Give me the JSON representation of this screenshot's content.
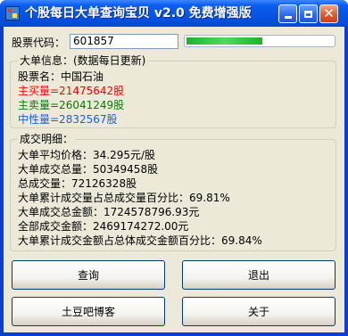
{
  "window": {
    "title": "个股每日大单查询宝贝 v2.0 免费增强版"
  },
  "query": {
    "stock_code_label": "股票代码：",
    "stock_code_value": "601857",
    "progress": 0.52
  },
  "big_order_group": {
    "title": "大单信息：(数据每日更新)",
    "stock_name": "股票名：中国石油",
    "active_buy": "主买量=21475642股",
    "active_sell": "主卖量=26041249股",
    "neutral": "中性量=2832567股"
  },
  "detail_group": {
    "title": "成交明细：",
    "lines": [
      "大单平均价格：34.295元/股",
      "大单成交总量：50349458股",
      "总成交量：72126328股",
      "大单累计成交量占总成交量百分比：69.81%",
      "大单成交总金额：1724578796.93元",
      "全部成交金额：2469174272.00元",
      "大单累计成交金额占总体成交金额百分比：69.84%"
    ]
  },
  "buttons": {
    "query": "查询",
    "exit": "退出",
    "blog": "土豆吧博客",
    "about": "关于"
  }
}
